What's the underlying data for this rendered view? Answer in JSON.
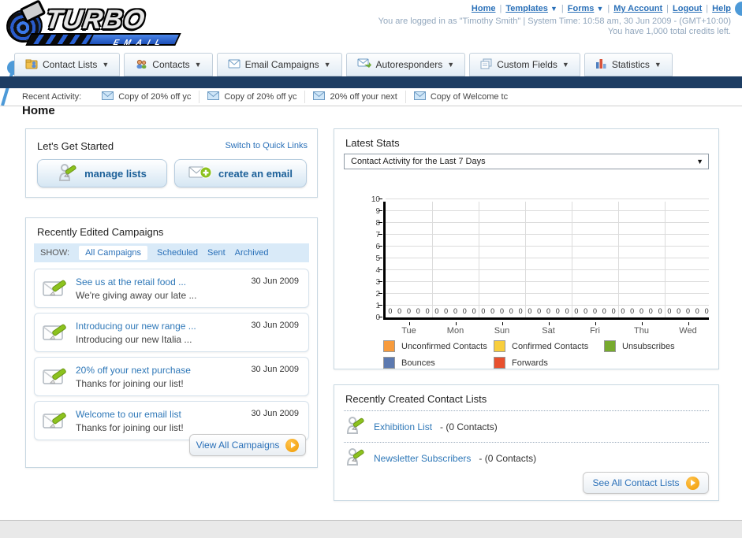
{
  "header": {
    "logo": {
      "word1": "TURBO",
      "word2": "EMAIL"
    },
    "nav": [
      {
        "label": "Home",
        "caret": false
      },
      {
        "label": "Templates",
        "caret": true
      },
      {
        "label": "Forms",
        "caret": true
      },
      {
        "label": "My Account",
        "caret": false
      },
      {
        "label": "Logout",
        "caret": false
      },
      {
        "label": "Help",
        "caret": false
      }
    ],
    "login_line": "You are logged in as \"Timothy Smith\" | System Time: 10:58 am, 30 Jun 2009 - (GMT+10:00)",
    "credits_line": "You have 1,000 total credits left."
  },
  "tabs": [
    {
      "label": "Contact Lists",
      "icon": "contact-lists"
    },
    {
      "label": "Contacts",
      "icon": "contacts"
    },
    {
      "label": "Email Campaigns",
      "icon": "envelope"
    },
    {
      "label": "Autoresponders",
      "icon": "envelope-arrow"
    },
    {
      "label": "Custom Fields",
      "icon": "pages"
    },
    {
      "label": "Statistics",
      "icon": "bar-chart"
    }
  ],
  "recent_activity": {
    "label": "Recent Activity:",
    "items": [
      "Copy of 20% off yc",
      "Copy of 20% off yc",
      "20% off your next ",
      "Copy of Welcome tc"
    ]
  },
  "page": {
    "heading": "Home"
  },
  "get_started": {
    "title": "Let's Get Started",
    "switch_link": "Switch to Quick Links",
    "buttons": [
      {
        "label": "manage lists",
        "icon": "person-pencil"
      },
      {
        "label": "create an email",
        "icon": "envelope-plus"
      }
    ]
  },
  "campaigns": {
    "title": "Recently Edited Campaigns",
    "show_label": "SHOW:",
    "filters": [
      "All Campaigns",
      "Scheduled",
      "Sent",
      "Archived"
    ],
    "active_filter": "All Campaigns",
    "items": [
      {
        "title": "See us at the retail food ...",
        "subtitle": "We're giving away our late ...",
        "date": "30 Jun 2009"
      },
      {
        "title": "Introducing our new range ...",
        "subtitle": "Introducing our new Italia ...",
        "date": "30 Jun 2009"
      },
      {
        "title": "20% off your next purchase",
        "subtitle": "Thanks for joining our list!",
        "date": "30 Jun 2009"
      },
      {
        "title": "Welcome to our email list",
        "subtitle": "Thanks for joining our list!",
        "date": "30 Jun 2009"
      }
    ],
    "view_all_label": "View All Campaigns"
  },
  "stats": {
    "title": "Latest Stats",
    "dropdown_value": "Contact Activity for the Last 7 Days"
  },
  "chart_data": {
    "type": "bar",
    "title": "Contact Activity for the Last 7 Days",
    "categories": [
      "Tue",
      "Mon",
      "Sun",
      "Sat",
      "Fri",
      "Thu",
      "Wed"
    ],
    "series": [
      {
        "name": "Unconfirmed Contacts",
        "color": "#f79b3c",
        "values": [
          0,
          0,
          0,
          0,
          0,
          0,
          0
        ]
      },
      {
        "name": "Confirmed Contacts",
        "color": "#f8ce3c",
        "values": [
          0,
          0,
          0,
          0,
          0,
          0,
          0
        ]
      },
      {
        "name": "Unsubscribes",
        "color": "#77aa2e",
        "values": [
          0,
          0,
          0,
          0,
          0,
          0,
          0
        ]
      },
      {
        "name": "Bounces",
        "color": "#5b79b0",
        "values": [
          0,
          0,
          0,
          0,
          0,
          0,
          0
        ]
      },
      {
        "name": "Forwards",
        "color": "#e8502e",
        "values": [
          0,
          0,
          0,
          0,
          0,
          0,
          0
        ]
      }
    ],
    "ylim": [
      0,
      10
    ],
    "ytick_step": 1,
    "grid": true,
    "legend_position": "bottom"
  },
  "contact_lists": {
    "title": "Recently Created Contact Lists",
    "items": [
      {
        "name": "Exhibition List",
        "detail": "- (0 Contacts)"
      },
      {
        "name": "Newsletter Subscribers",
        "detail": "- (0 Contacts)"
      }
    ],
    "see_all_label": "See All Contact Lists"
  }
}
